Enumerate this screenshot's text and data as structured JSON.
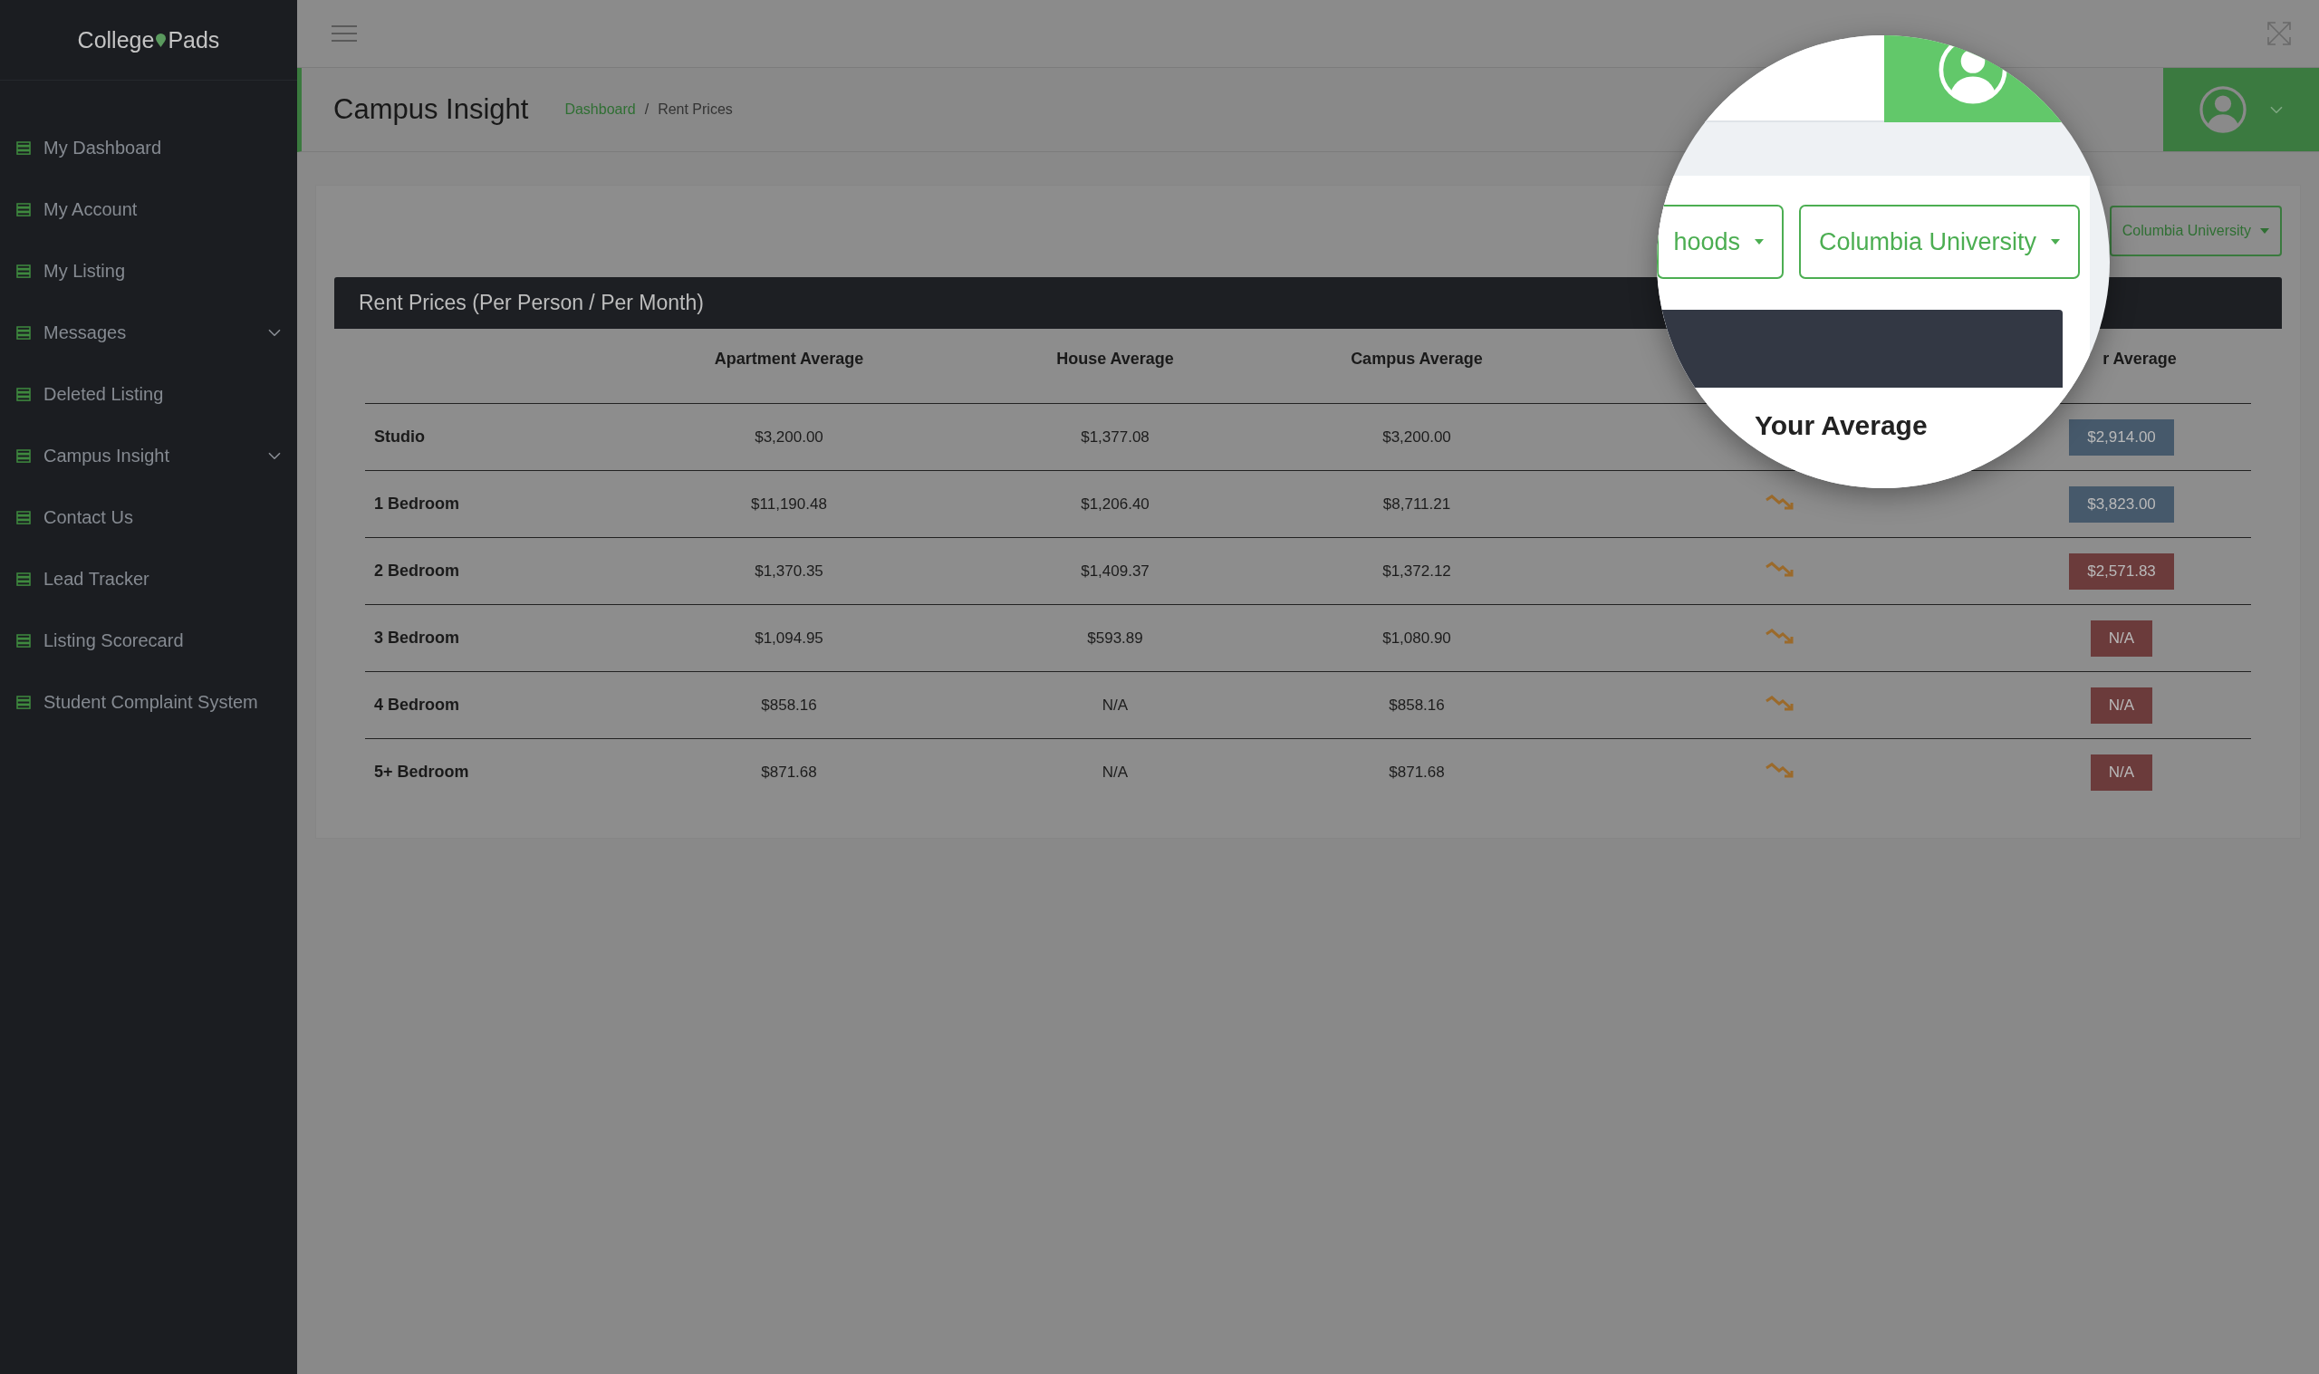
{
  "sidebar": {
    "brand": {
      "left": "College",
      "right": "Pads"
    },
    "items": [
      {
        "label": "My Dashboard",
        "kind": "link"
      },
      {
        "label": "My Account",
        "kind": "link"
      },
      {
        "label": "My Listing",
        "kind": "link"
      },
      {
        "label": "Messages",
        "kind": "submenu"
      },
      {
        "label": "Deleted Listing",
        "kind": "link"
      },
      {
        "label": "Campus Insight",
        "kind": "submenu"
      },
      {
        "label": "Contact Us",
        "kind": "link"
      },
      {
        "label": "Lead Tracker",
        "kind": "link"
      },
      {
        "label": "Listing Scorecard",
        "kind": "link"
      },
      {
        "label": "Student Complaint System",
        "kind": "link"
      }
    ]
  },
  "header": {
    "title": "Campus Insight",
    "breadcrumb": [
      {
        "label": "Dashboard",
        "kind": "link"
      },
      {
        "label": "Rent Prices",
        "kind": "current"
      }
    ],
    "separator": "/"
  },
  "filters": {
    "campus": "Columbia University"
  },
  "table": {
    "title": "Rent Prices (Per Person / Per Month)",
    "columns": [
      "",
      "Apartment Average",
      "House Average",
      "Campus Average",
      "",
      "r Average"
    ],
    "rows": [
      {
        "label": "Studio",
        "apartment": "$3,200.00",
        "house": "$1,377.08",
        "campus": "$3,200.00",
        "your": {
          "text": "$2,914.00",
          "color": "#46596b"
        }
      },
      {
        "label": "1 Bedroom",
        "apartment": "$11,190.48",
        "house": "$1,206.40",
        "campus": "$8,711.21",
        "your": {
          "text": "$3,823.00",
          "color": "#46596b"
        }
      },
      {
        "label": "2 Bedroom",
        "apartment": "$1,370.35",
        "house": "$1,409.37",
        "campus": "$1,372.12",
        "your": {
          "text": "$2,571.83",
          "color": "#6b3b3b"
        }
      },
      {
        "label": "3 Bedroom",
        "apartment": "$1,094.95",
        "house": "$593.89",
        "campus": "$1,080.90",
        "your": {
          "text": "N/A",
          "color": "#6b3b3b"
        }
      },
      {
        "label": "4 Bedroom",
        "apartment": "$858.16",
        "house": "N/A",
        "campus": "$858.16",
        "your": {
          "text": "N/A",
          "color": "#6b3b3b"
        }
      },
      {
        "label": "5+ Bedroom",
        "apartment": "$871.68",
        "house": "N/A",
        "campus": "$871.68",
        "your": {
          "text": "N/A",
          "color": "#6b3b3b"
        }
      }
    ]
  },
  "magnifier": {
    "dropdowns": [
      "hoods",
      "Columbia University"
    ],
    "column_heading": "Your Average"
  }
}
